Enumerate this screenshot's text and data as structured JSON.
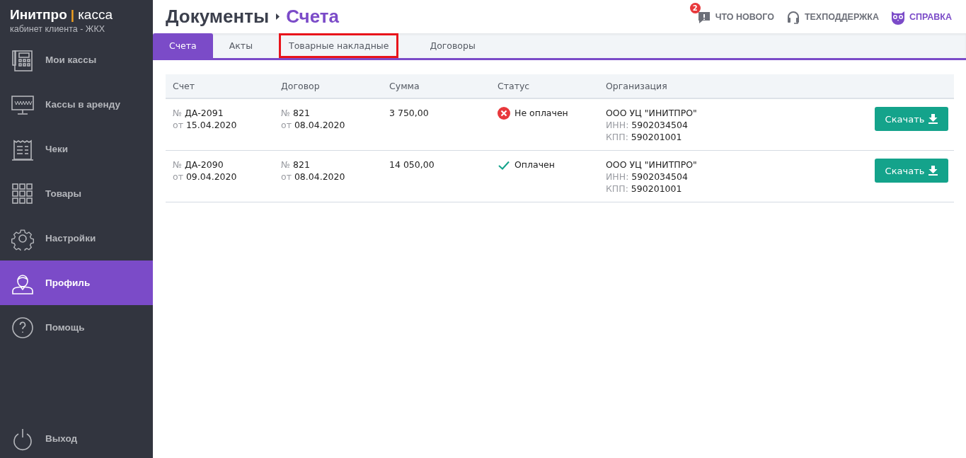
{
  "brand": {
    "name": "Инитпро",
    "separator": "|",
    "product": "касса",
    "subtitle": "кабинет клиента - ЖКХ"
  },
  "sidebar": {
    "items": [
      {
        "kind": "registers",
        "label": "Мои кассы",
        "selected": false
      },
      {
        "kind": "rent",
        "label": "Кассы в аренду",
        "selected": false
      },
      {
        "kind": "receipts",
        "label": "Чеки",
        "selected": false
      },
      {
        "kind": "goods",
        "label": "Товары",
        "selected": false
      },
      {
        "kind": "settings",
        "label": "Настройки",
        "selected": false
      },
      {
        "kind": "profile",
        "label": "Профиль",
        "selected": true
      },
      {
        "kind": "help",
        "label": "Помощь",
        "selected": false
      }
    ],
    "logout": {
      "label": "Выход"
    }
  },
  "header": {
    "breadcrumb": [
      "Документы",
      "Счета"
    ],
    "links": [
      {
        "kind": "news",
        "label": "ЧТО НОВОГО",
        "badge": "2"
      },
      {
        "kind": "support",
        "label": "ТЕХПОДДЕРЖКА"
      },
      {
        "kind": "reference",
        "label": "СПРАВКА"
      }
    ]
  },
  "tabs": [
    {
      "label": "Счета",
      "selected": true,
      "highlighted": false
    },
    {
      "label": "Акты",
      "selected": false,
      "highlighted": false
    },
    {
      "label": "Товарные накладные",
      "selected": false,
      "highlighted": true
    },
    {
      "label": "Договоры",
      "selected": false,
      "highlighted": false
    }
  ],
  "table": {
    "columns": [
      "Счет",
      "Договор",
      "Сумма",
      "Статус",
      "Организация"
    ],
    "rows": [
      {
        "invoice": {
          "number_label": "№",
          "number": "ДА-2091",
          "date_label": "от",
          "date": "15.04.2020"
        },
        "contract": {
          "number_label": "№",
          "number": "821",
          "date_label": "от",
          "date": "08.04.2020"
        },
        "amount": "3 750,00",
        "status": {
          "kind": "unpaid",
          "label": "Не оплачен"
        },
        "organization": {
          "name": "ООО УЦ \"ИНИТПРО\"",
          "inn_label": "ИНН:",
          "inn": "5902034504",
          "kpp_label": "КПП:",
          "kpp": "590201001"
        },
        "button": "Скачать"
      },
      {
        "invoice": {
          "number_label": "№",
          "number": "ДА-2090",
          "date_label": "от",
          "date": "09.04.2020"
        },
        "contract": {
          "number_label": "№",
          "number": "821",
          "date_label": "от",
          "date": "08.04.2020"
        },
        "amount": "14 050,00",
        "status": {
          "kind": "paid",
          "label": "Оплачен"
        },
        "organization": {
          "name": "ООО УЦ \"ИНИТПРО\"",
          "inn_label": "ИНН:",
          "inn": "5902034504",
          "kpp_label": "КПП:",
          "kpp": "590201001"
        },
        "button": "Скачать"
      }
    ]
  }
}
